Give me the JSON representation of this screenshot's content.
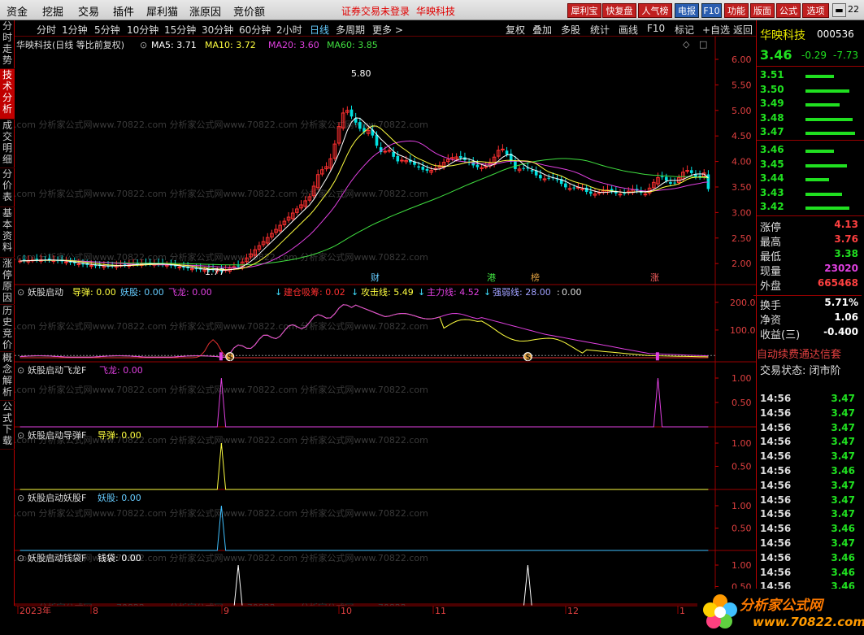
{
  "menu": {
    "items": [
      "资金",
      "挖掘",
      "交易",
      "插件",
      "犀利猫",
      "涨原因",
      "竞价额"
    ],
    "notice": "证券交易未登录",
    "stock_link": "华映科技",
    "right_buttons": [
      "犀利宝",
      "快复盘",
      "人气榜",
      "电报",
      "F10",
      "功能",
      "版面",
      "公式",
      "选项"
    ],
    "badge": "22"
  },
  "leftnav": [
    "分时走势",
    "技术分析",
    "成交明细",
    "分价表",
    "基本资料",
    "涨停原因",
    "历史竞价",
    "概念解析",
    "公式下载"
  ],
  "periods": [
    "分时",
    "1分钟",
    "5分钟",
    "10分钟",
    "15分钟",
    "30分钟",
    "60分钟",
    "2小时",
    "日线",
    "多周期",
    "更多 >"
  ],
  "active_period": "日线",
  "toolbar": [
    "复权",
    "叠加",
    "多股",
    "统计",
    "画线",
    "F10",
    "标记",
    "+自选",
    "返回"
  ],
  "main_chart": {
    "title": "华映科技(日线 等比前复权)",
    "ma5": "MA5: 3.71",
    "ma10": "MA10: 3.72",
    "ma20": "MA20: 3.60",
    "ma60": "MA60: 3.85",
    "high_label": "5.80",
    "low_label": "1.77",
    "y_ticks": [
      "6.00",
      "5.50",
      "5.00",
      "4.50",
      "4.00",
      "3.50",
      "3.00",
      "2.50",
      "2.00"
    ],
    "markers": [
      "财",
      "港",
      "榜",
      "涨"
    ]
  },
  "panel1": {
    "name": "妖股启动",
    "daodan": "导弹: 0.00",
    "yaogu": "妖股: 0.00",
    "feilong": "飞龙: 0.00",
    "jiancang": "建仓吸筹: 0.02",
    "gongji": "攻击线: 5.49",
    "zhuli": "主力线: 4.52",
    "qiangruo": "强弱线: 28.00",
    "colon": ":",
    "zero": "0.00",
    "y_ticks": [
      "200.0",
      "100.0"
    ],
    "icon_char": "$"
  },
  "panel2": {
    "name": "妖股启动飞龙F",
    "label": "飞龙: 0.00",
    "y_ticks": [
      "1.00",
      "0.50"
    ]
  },
  "panel3": {
    "name": "妖股启动导弹F",
    "label": "导弹: 0.00",
    "y_ticks": [
      "1.00",
      "0.50"
    ]
  },
  "panel4": {
    "name": "妖股启动妖股F",
    "label": "妖股: 0.00",
    "y_ticks": [
      "1.00",
      "0.50"
    ]
  },
  "panel5": {
    "name": "妖股启动钱袋F",
    "label": "钱袋: 0.00",
    "y_ticks": [
      "1.00",
      "0.50"
    ]
  },
  "xaxis": {
    "labels": [
      "2023年",
      "8",
      "9",
      "10",
      "11",
      "12",
      "1"
    ]
  },
  "watermark": "2.com 分析家公式网www.70822.com 分析家公式网www.70822.com 分析家公式网www.70822.com",
  "quote": {
    "name": "华映科技",
    "code": "000536",
    "price": "3.46",
    "change": "-0.29",
    "pct": "-7.73",
    "asks": [
      [
        "3.51",
        0.55
      ],
      [
        "3.50",
        0.85
      ],
      [
        "3.49",
        0.65
      ],
      [
        "3.48",
        0.9
      ],
      [
        "3.47",
        0.95
      ]
    ],
    "bids": [
      [
        "3.46",
        0.55
      ],
      [
        "3.45",
        0.8
      ],
      [
        "3.44",
        0.45
      ],
      [
        "3.43",
        0.7
      ],
      [
        "3.42",
        0.85
      ]
    ],
    "stats": [
      {
        "k": "涨停",
        "v": "4.13",
        "c": "#ff4040"
      },
      {
        "k": "最高",
        "v": "3.76",
        "c": "#ff4040"
      },
      {
        "k": "最低",
        "v": "3.38",
        "c": "#20e020"
      },
      {
        "k": "现量",
        "v": "23020",
        "c": "#e040e0"
      },
      {
        "k": "外盘",
        "v": "665468",
        "c": "#ff4040"
      },
      {
        "k": "换手",
        "v": "5.71%",
        "c": "#ffffff"
      },
      {
        "k": "净资",
        "v": "1.06",
        "c": "#ffffff"
      },
      {
        "k": "收益(三)",
        "v": "-0.400",
        "c": "#ffffff"
      }
    ],
    "ad_text": "自动续费通达信套",
    "trade_state": "交易状态: 闭市阶",
    "ticks": [
      [
        "14:56",
        "3.47"
      ],
      [
        "14:56",
        "3.47"
      ],
      [
        "14:56",
        "3.47"
      ],
      [
        "14:56",
        "3.47"
      ],
      [
        "14:56",
        "3.47"
      ],
      [
        "14:56",
        "3.46"
      ],
      [
        "14:56",
        "3.47"
      ],
      [
        "14:56",
        "3.47"
      ],
      [
        "14:56",
        "3.47"
      ],
      [
        "14:56",
        "3.46"
      ],
      [
        "14:56",
        "3.47"
      ],
      [
        "14:56",
        "3.46"
      ],
      [
        "14:56",
        "3.46"
      ],
      [
        "14:56",
        "3.46"
      ]
    ]
  },
  "logo": {
    "text": "分析家公式网",
    "url": "www.70822.com"
  },
  "colors": {
    "up": "#ff3030",
    "down": "#00e0e0",
    "ma5": "#ffffff",
    "ma10": "#ffff40",
    "ma20": "#e040e0",
    "ma60": "#40e040"
  }
}
